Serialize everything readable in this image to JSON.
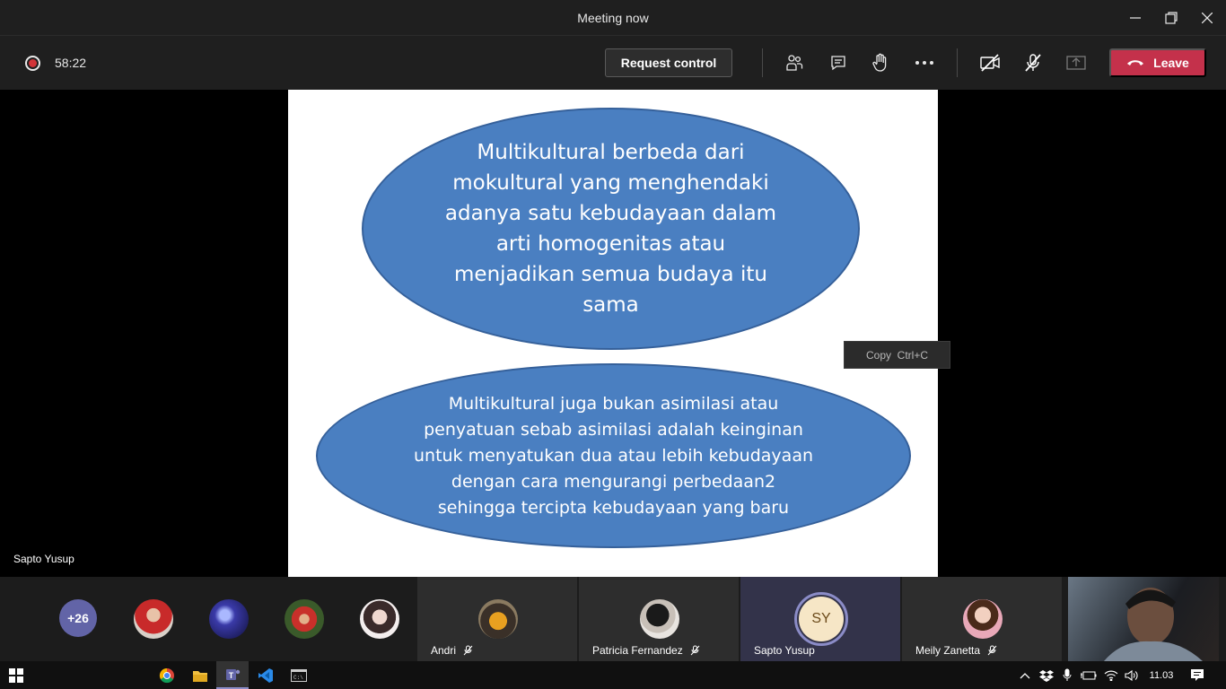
{
  "window": {
    "title": "Meeting now"
  },
  "toolbar": {
    "timer": "58:22",
    "request_control_label": "Request control",
    "leave_label": "Leave",
    "icons": [
      "participants-icon",
      "chat-icon",
      "raise-hand-icon",
      "more-options-icon",
      "camera-off-icon",
      "mic-muted-icon",
      "share-tray-icon"
    ]
  },
  "slide": {
    "ellipse_top_lines": [
      "Multikultural berbeda dari",
      "mokultural yang menghendaki",
      "adanya satu kebudayaan dalam",
      "arti homogenitas atau",
      "menjadikan semua budaya itu",
      "sama"
    ],
    "ellipse_bottom_lines": [
      "Multikultural juga bukan asimilasi atau",
      "penyatuan sebab asimilasi adalah keinginan",
      "untuk menyatukan dua atau lebih kebudayaan",
      "dengan cara mengurangi perbedaan2",
      "sehingga tercipta kebudayaan yang baru"
    ],
    "fill_color": "#4a7fc1"
  },
  "copy_tooltip": {
    "label": "Copy",
    "shortcut": "Ctrl+C"
  },
  "presenter_name": "Sapto Yusup",
  "roster": {
    "overflow_count": "+26",
    "tiles": [
      {
        "name": "Andri",
        "muted": true
      },
      {
        "name": "Patricia Fernandez",
        "muted": true
      },
      {
        "name": "Sapto Yusup",
        "initials": "SY",
        "muted": false
      },
      {
        "name": "Meily Zanetta",
        "muted": true
      }
    ]
  },
  "taskbar": {
    "apps": [
      "windows-start-icon",
      "chrome-icon",
      "file-explorer-icon",
      "teams-icon",
      "vscode-icon",
      "terminal-icon"
    ],
    "clock": "11.03"
  },
  "colors": {
    "leave": "#c4314b",
    "teams_purple": "#6264a7",
    "recording": "#d13438"
  }
}
